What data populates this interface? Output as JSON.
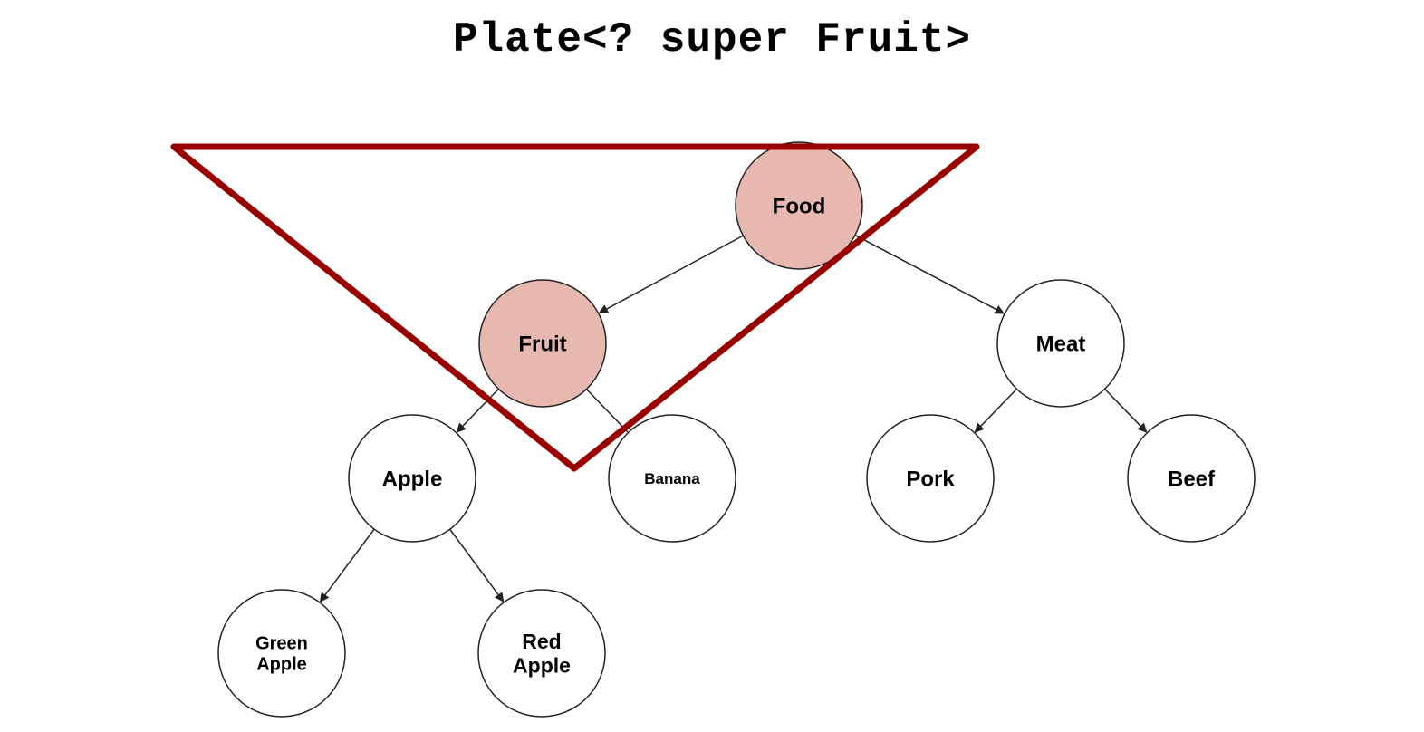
{
  "title": "Plate<? super Fruit>",
  "colors": {
    "highlight_fill": "#e6b8af",
    "node_fill": "#ffffff",
    "node_stroke": "#222222",
    "edge_stroke": "#222222",
    "triangle_stroke": "#990000"
  },
  "nodes": [
    {
      "id": "food",
      "lines": [
        "Food"
      ],
      "highlighted": true
    },
    {
      "id": "fruit",
      "lines": [
        "Fruit"
      ],
      "highlighted": true
    },
    {
      "id": "meat",
      "lines": [
        "Meat"
      ],
      "highlighted": false
    },
    {
      "id": "apple",
      "lines": [
        "Apple"
      ],
      "highlighted": false
    },
    {
      "id": "banana",
      "lines": [
        "Banana"
      ],
      "highlighted": false
    },
    {
      "id": "pork",
      "lines": [
        "Pork"
      ],
      "highlighted": false
    },
    {
      "id": "beef",
      "lines": [
        "Beef"
      ],
      "highlighted": false
    },
    {
      "id": "green-apple",
      "lines": [
        "Green",
        "Apple"
      ],
      "highlighted": false
    },
    {
      "id": "red-apple",
      "lines": [
        "Red",
        "Apple"
      ],
      "highlighted": false
    }
  ],
  "edges": [
    {
      "from": "food",
      "to": "fruit",
      "arrow": true
    },
    {
      "from": "food",
      "to": "meat",
      "arrow": true
    },
    {
      "from": "fruit",
      "to": "apple",
      "arrow": true
    },
    {
      "from": "fruit",
      "to": "banana",
      "arrow": false
    },
    {
      "from": "meat",
      "to": "pork",
      "arrow": true
    },
    {
      "from": "meat",
      "to": "beef",
      "arrow": true
    },
    {
      "from": "apple",
      "to": "green-apple",
      "arrow": true
    },
    {
      "from": "apple",
      "to": "red-apple",
      "arrow": true
    }
  ],
  "bound_marker": {
    "shape": "inverted-triangle",
    "meaning": "lower bound: Fruit and its supertypes"
  }
}
